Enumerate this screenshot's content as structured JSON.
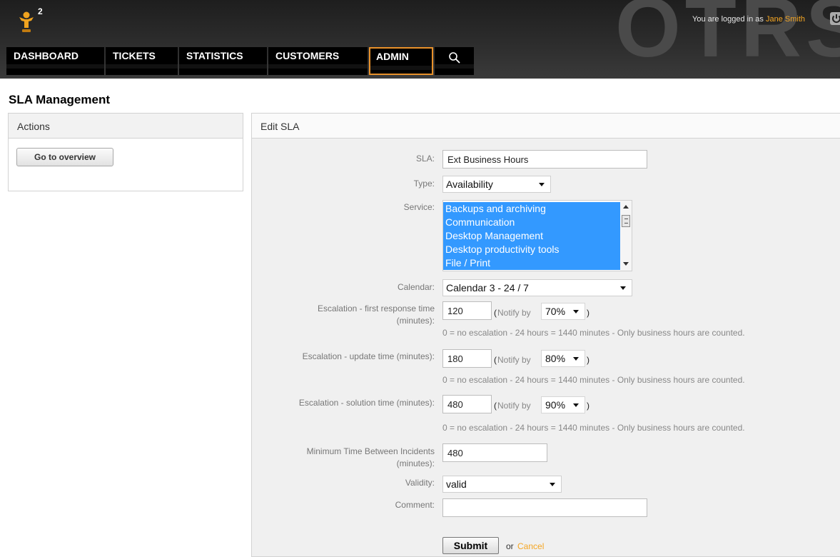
{
  "header": {
    "notification_count": "2",
    "logo_text": "OTRS",
    "login_prefix": "You are logged in as",
    "user_name": "Jane Smith",
    "nav": [
      {
        "label": "DASHBOARD"
      },
      {
        "label": "TICKETS"
      },
      {
        "label": "STATISTICS"
      },
      {
        "label": "CUSTOMERS"
      },
      {
        "label": "ADMIN",
        "active": true
      }
    ],
    "accent_color": "#e8912a"
  },
  "page": {
    "title": "SLA Management"
  },
  "sidebar": {
    "header": "Actions",
    "button_label": "Go to overview"
  },
  "main": {
    "header": "Edit SLA",
    "form": {
      "sla_label": "SLA:",
      "sla_value": "Ext Business Hours",
      "type_label": "Type:",
      "type_value": "Availability",
      "service_label": "Service:",
      "service_options": [
        "Backups and archiving",
        "Communication",
        "Desktop Management",
        "Desktop productivity tools",
        "File / Print"
      ],
      "calendar_label": "Calendar:",
      "calendar_value": "Calendar 3 - 24 / 7",
      "first_response_label_1": "Escalation - first response time",
      "first_response_label_2": "(minutes):",
      "first_response_value": "120",
      "first_response_notify": "70%",
      "update_label": "Escalation - update time (minutes):",
      "update_value": "180",
      "update_notify": "80%",
      "solution_label": "Escalation - solution time (minutes):",
      "solution_value": "480",
      "solution_notify": "90%",
      "notify_by": "Notify by",
      "hint": "0 = no escalation - 24 hours = 1440 minutes - Only business hours are counted.",
      "min_time_label_1": "Minimum Time Between Incidents",
      "min_time_label_2": "(minutes):",
      "min_time_value": "480",
      "validity_label": "Validity:",
      "validity_value": "valid",
      "comment_label": "Comment:",
      "comment_value": "",
      "submit_label": "Submit",
      "or_text": "or",
      "cancel_label": "Cancel"
    }
  }
}
